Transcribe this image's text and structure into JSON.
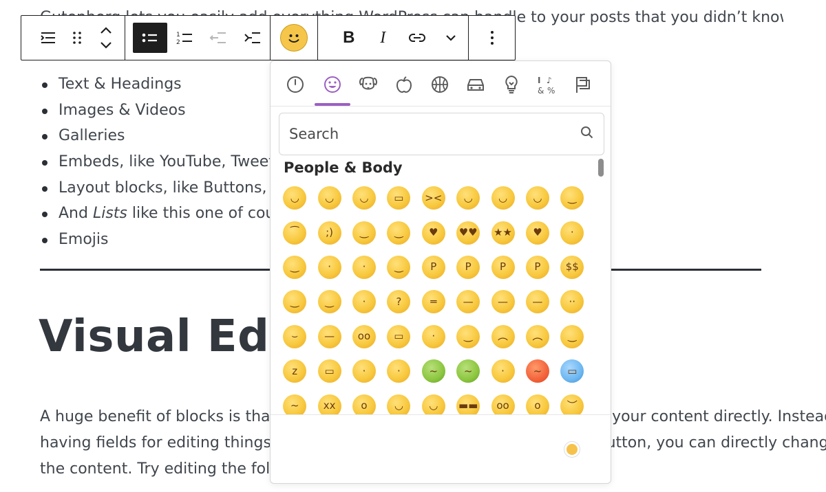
{
  "content": {
    "intro": "Gutenberg lets you easily add everything WordPress can handle to your posts that you didn’t know",
    "list_items": [
      {
        "text": "Text & Headings",
        "italic_part": "",
        "tail": ""
      },
      {
        "text": "Images & Videos",
        "italic_part": "",
        "tail": ""
      },
      {
        "text": "Galleries",
        "italic_part": "",
        "tail": ""
      },
      {
        "text": "Embeds, like YouTube, Tweets,",
        "italic_part": "",
        "tail": ""
      },
      {
        "text": "Layout blocks, like Buttons, Her",
        "italic_part": "",
        "tail": ""
      },
      {
        "text": "And ",
        "italic_part": "Lists",
        "tail": " like this one of course"
      },
      {
        "text": "Emojis",
        "italic_part": "",
        "tail": ""
      }
    ],
    "heading": "Visual Editing",
    "paragraph_lines": [
      "A huge benefit of blocks is that you can edit them in place and manipulate your content directly. Instead of",
      "having fields for editing things like the source of a quote, or the text of a button, you can directly change",
      "the content. Try editing the following quote:"
    ]
  },
  "toolbar": {
    "block_icon": "list-block-icon",
    "drag_handle": "drag-handle-icon",
    "move": "move-up-down-icon",
    "list_buttons": [
      {
        "name": "unordered-list-button",
        "icon": "unordered-list-icon",
        "active": true
      },
      {
        "name": "ordered-list-button",
        "icon": "ordered-list-icon",
        "active": false
      },
      {
        "name": "outdent-button",
        "icon": "outdent-icon",
        "active": false,
        "disabled": true
      },
      {
        "name": "indent-button",
        "icon": "indent-icon",
        "active": false
      }
    ],
    "emoji_button": "smiley-icon",
    "bold_label": "B",
    "italic_label": "I",
    "link_icon": "link-icon",
    "more_icon": "chevron-down-icon",
    "options_icon": "more-vertical-icon"
  },
  "picker": {
    "categories": [
      "recent-clock-icon",
      "smileys-icon",
      "animals-icon",
      "food-icon",
      "activity-icon",
      "travel-icon",
      "objects-icon",
      "symbols-icon",
      "flags-icon"
    ],
    "active_category": 1,
    "search_placeholder": "Search",
    "section_title": "People & Body",
    "skin_tone_color": "#f6c24b",
    "accent_color": "#9b5fc2",
    "emojis": [
      "grinning-face",
      "grinning-face-big-eyes",
      "grinning-face-smiling-eyes",
      "beaming-face",
      "grinning-squinting-face",
      "grinning-face-sweat",
      "rolling-on-floor-laughing",
      "tears-of-joy",
      "slightly-smiling-face",
      "upside-down-face",
      "winking-face",
      "smiling-face-smiling-eyes",
      "smiling-face-halo",
      "smiling-face-hearts",
      "heart-eyes",
      "star-struck",
      "face-blowing-kiss",
      "kissing-face",
      "smiling-face",
      "kissing-face-closed-eyes",
      "kissing-face-smiling-eyes",
      "face-savoring-food",
      "face-with-tongue",
      "winking-face-tongue",
      "zany-face",
      "squinting-face-tongue",
      "money-mouth-face",
      "hugging-face",
      "face-hand-over-mouth",
      "shushing-face",
      "thinking-face",
      "zipper-mouth-face",
      "raised-eyebrow",
      "neutral-face",
      "expressionless-face",
      "face-without-mouth",
      "smirking-face",
      "unamused-face",
      "rolling-eyes",
      "grimacing-face",
      "lying-face",
      "relieved-face",
      "pensive-face",
      "sleepy-face",
      "drooling-face",
      "sleeping-face",
      "face-medical-mask",
      "face-thermometer",
      "face-head-bandage",
      "nauseated-face",
      "vomiting-face",
      "sneezing-face",
      "hot-face",
      "cold-face",
      "woozy-face",
      "dizzy-face",
      "exploding-head",
      "cowboy-hat-face",
      "partying-face",
      "smiling-face-sunglasses",
      "nerd-face",
      "face-monocle",
      "confused-face"
    ]
  }
}
